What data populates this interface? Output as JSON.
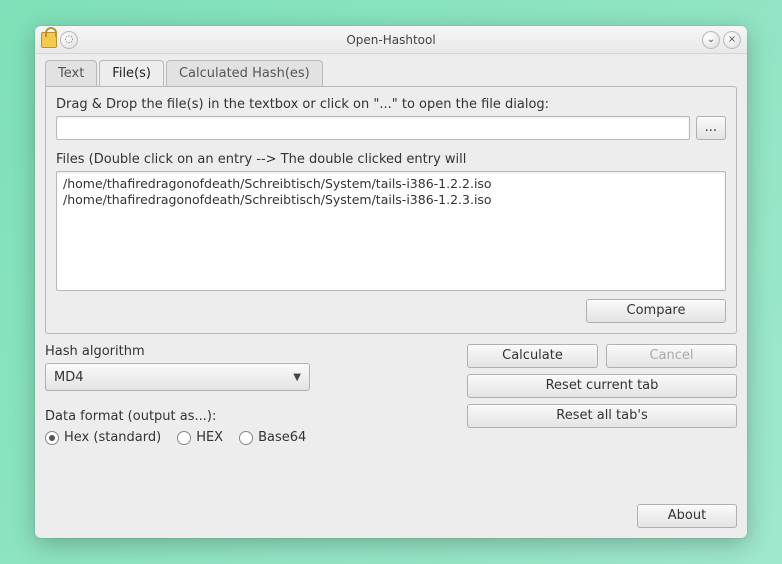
{
  "window": {
    "title": "Open-Hashtool"
  },
  "tabs": {
    "text": "Text",
    "files": "File(s)",
    "hashes": "Calculated Hash(es)"
  },
  "filesPanel": {
    "dragDropLabel": "Drag & Drop the file(s) in the textbox or click on \"...\" to open the file dialog:",
    "browseLabel": "...",
    "listLabel": "Files (Double click on an entry --> The double clicked entry will",
    "items": [
      "/home/thafiredragonofdeath/Schreibtisch/System/tails-i386-1.2.2.iso",
      "/home/thafiredragonofdeath/Schreibtisch/System/tails-i386-1.2.3.iso"
    ],
    "compare": "Compare"
  },
  "hashAlgo": {
    "label": "Hash algorithm",
    "selected": "MD4"
  },
  "dataFormat": {
    "label": "Data format (output as...):",
    "options": {
      "hexStd": "Hex (standard)",
      "hexUpper": "HEX",
      "base64": "Base64"
    }
  },
  "buttons": {
    "calculate": "Calculate",
    "cancel": "Cancel",
    "resetCurrent": "Reset current tab",
    "resetAll": "Reset all tab's",
    "about": "About"
  }
}
